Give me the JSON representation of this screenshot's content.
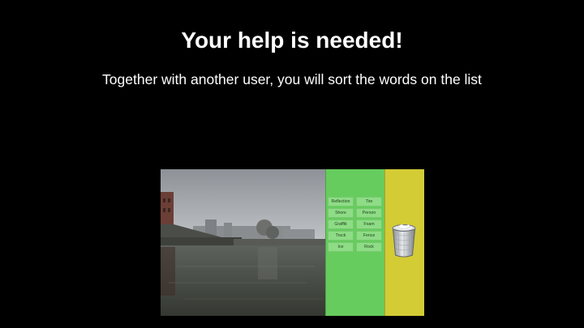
{
  "slide": {
    "title": "Your help is needed!",
    "subtitle": "Together with another user, you will sort the words on the list"
  },
  "word_list": [
    "Reflection",
    "Tire",
    "Shore",
    "Person",
    "Graffiti",
    "Foam",
    "Truck",
    "Fence",
    "Ice",
    "Rock"
  ],
  "colors": {
    "background": "#000000",
    "word_panel": "#66cc5e",
    "trash_panel": "#d4cc35"
  },
  "icons": {
    "trash": "trash-can-icon"
  }
}
